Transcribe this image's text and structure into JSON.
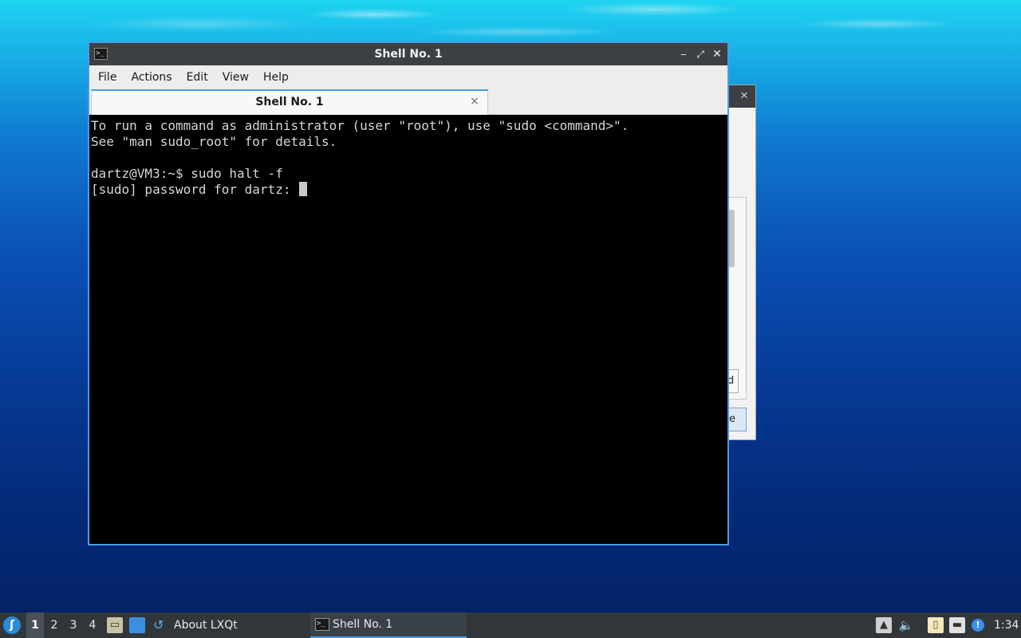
{
  "window": {
    "title": "Shell No. 1",
    "app_icon": "terminal-icon",
    "controls": {
      "minimize": "‒",
      "maximize": "⤢",
      "close": "✕"
    }
  },
  "menubar": {
    "items": [
      "File",
      "Actions",
      "Edit",
      "View",
      "Help"
    ]
  },
  "tabs": [
    {
      "label": "Shell No. 1",
      "close": "×"
    }
  ],
  "terminal": {
    "lines": [
      "To run a command as administrator (user \"root\"), use \"sudo <command>\".",
      "See \"man sudo_root\" for details.",
      "",
      "dartz@VM3:~$ sudo halt -f",
      "[sudo] password for dartz: "
    ]
  },
  "background_dialog": {
    "button1_fragment": "d",
    "button2_fragment": "e"
  },
  "taskbar": {
    "workspaces": [
      "1",
      "2",
      "3",
      "4"
    ],
    "active_workspace": "1",
    "about_label": "About LXQt",
    "task_label": "Shell No. 1",
    "clock": "1:34",
    "icons": {
      "start": "lxqt-menu-icon",
      "files": "file-manager-icon",
      "desktop": "show-desktop-icon",
      "about": "lxqt-about-icon",
      "updown": "updown-arrow-icon",
      "volume": "volume-icon",
      "clipboard": "clipboard-icon",
      "network": "network-icon",
      "notify": "notification-icon"
    }
  },
  "colors": {
    "accent": "#4a9be8",
    "titlebar": "#3c3f44",
    "terminal_bg": "#000000",
    "terminal_fg": "#d6d6d6",
    "taskbar": "#31363b"
  }
}
